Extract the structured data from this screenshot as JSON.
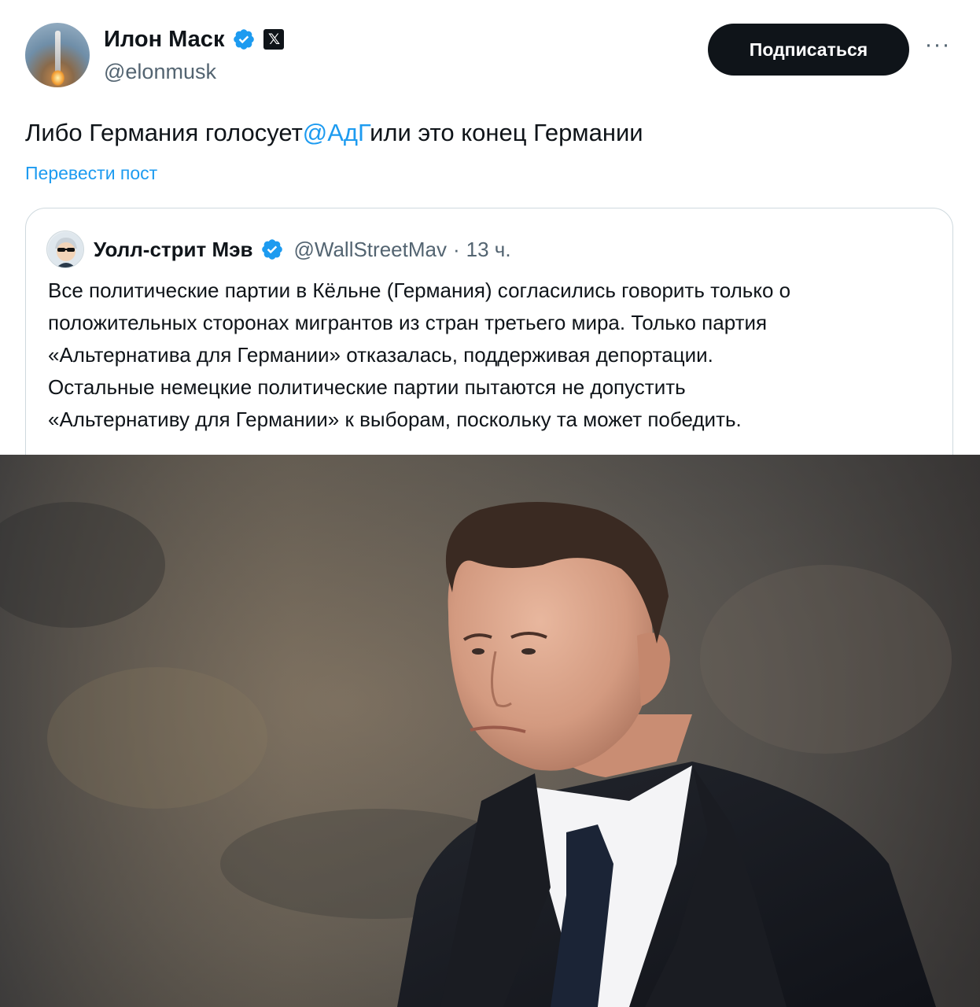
{
  "tweet": {
    "author_name": "Илон Маск",
    "author_handle": "@elonmusk",
    "affiliate_badge": "𝕏",
    "follow_label": "Подписаться",
    "more_label": "···",
    "text_before": "Либо Германия голосует",
    "mention": "@АдГ",
    "text_after": "или это конец Германии",
    "translate_label": "Перевести пост"
  },
  "quoted": {
    "author_name": "Уолл-стрит Мэв",
    "author_handle": "@WallStreetMav",
    "separator": "·",
    "time": "13 ч.",
    "lines": [
      "Все политические партии в Кёльне (Германия) согласились говорить только о",
      "положительных сторонах мигрантов из стран третьего мира. Только партия",
      "«Альтернатива для Германии» отказалась, поддерживая депортации.",
      "Остальные немецкие политические партии пытаются не допустить",
      "«Альтернативу для Германии» к выборам, поскольку та может победить."
    ]
  },
  "colors": {
    "text": "#0f1419",
    "secondary": "#536471",
    "link": "#1d9bf0",
    "button_bg": "#0f1419",
    "verified": "#1d9bf0",
    "border": "#cfd9de"
  },
  "icons": {
    "verified": "verified-badge-icon",
    "x_logo": "x-logo-icon",
    "more": "more-dots-icon"
  }
}
